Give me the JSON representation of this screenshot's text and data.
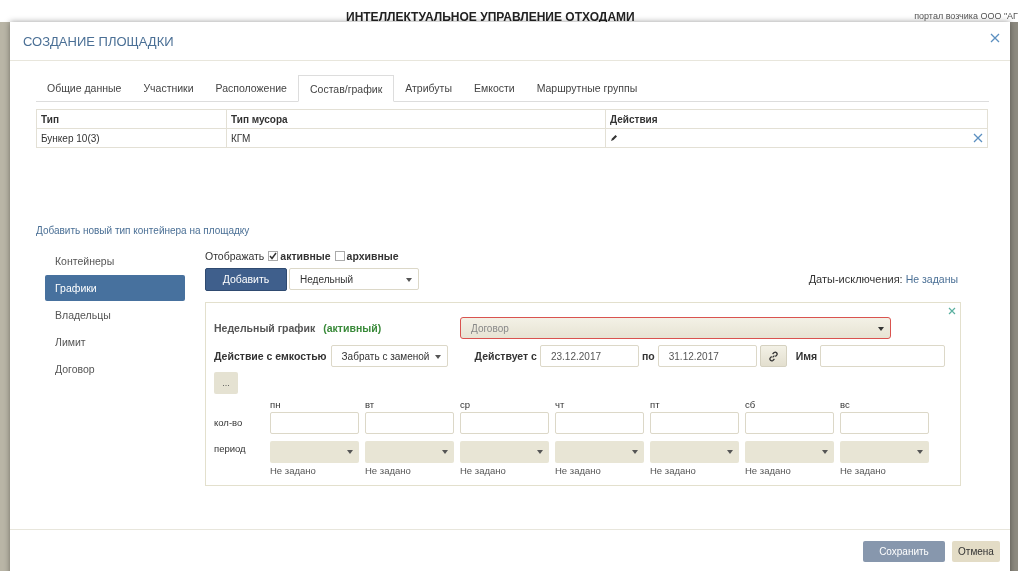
{
  "background": {
    "title": "ИНТЕЛЛЕКТУАЛЬНОЕ УПРАВЛЕНИЕ ОТХОДАМИ",
    "portal": "портал возчика ООО \"АГ"
  },
  "modal": {
    "title": "СОЗДАНИЕ ПЛОЩАДКИ"
  },
  "tabs": [
    {
      "label": "Общие данные",
      "selected": false
    },
    {
      "label": "Участники",
      "selected": false
    },
    {
      "label": "Расположение",
      "selected": false
    },
    {
      "label": "Состав/график",
      "selected": true
    },
    {
      "label": "Атрибуты",
      "selected": false
    },
    {
      "label": "Емкости",
      "selected": false
    },
    {
      "label": "Маршрутные группы",
      "selected": false
    }
  ],
  "table": {
    "columns": [
      "Тип",
      "Тип мусора",
      "Действия"
    ],
    "rows": [
      {
        "type": "Бункер 10(3)",
        "waste_type": "КГМ"
      }
    ]
  },
  "add_link": "Добавить новый тип контейнера на площадку",
  "sidebar": {
    "items": [
      {
        "label": "Контейнеры",
        "selected": false
      },
      {
        "label": "Графики",
        "selected": true
      },
      {
        "label": "Владельцы",
        "selected": false
      },
      {
        "label": "Лимит",
        "selected": false
      },
      {
        "label": "Договор",
        "selected": false
      }
    ]
  },
  "filter": {
    "label": "Отображать",
    "options": [
      {
        "label": "активные",
        "checked": true
      },
      {
        "label": "архивные",
        "checked": false
      }
    ]
  },
  "add_button": "Добавить",
  "schedule_type": "Недельный",
  "exceptions": {
    "label": "Даты-исключения:",
    "value": "Не заданы"
  },
  "schedule": {
    "title": "Недельный график",
    "status": "(активный)",
    "contract_placeholder": "Договор",
    "action_label": "Действие с емкостью",
    "action_value": "Забрать с заменой",
    "from_label": "Действует с",
    "date_from": "23.12.2017",
    "to_label": "по",
    "date_to": "31.12.2017",
    "name_label": "Имя",
    "more_button": "...",
    "qty_label": "кол-во",
    "period_label": "период",
    "days": [
      {
        "day": "пн",
        "period": "Не задано"
      },
      {
        "day": "вт",
        "period": "Не задано"
      },
      {
        "day": "ср",
        "period": "Не задано"
      },
      {
        "day": "чт",
        "period": "Не задано"
      },
      {
        "day": "пт",
        "period": "Не задано"
      },
      {
        "day": "сб",
        "period": "Не задано"
      },
      {
        "day": "вс",
        "period": "Не задано"
      }
    ]
  },
  "footer": {
    "save": "Сохранить",
    "cancel": "Отмена"
  }
}
